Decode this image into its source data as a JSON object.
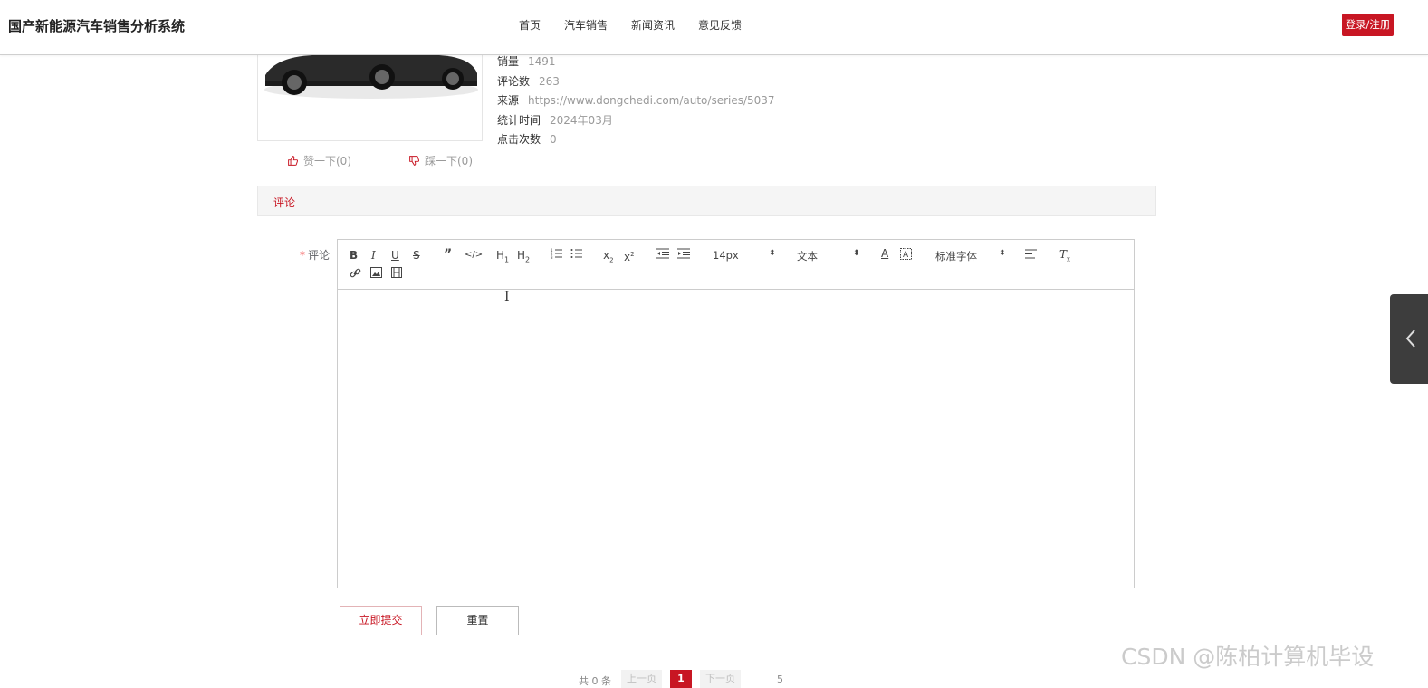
{
  "header": {
    "brand": "国产新能源汽车销售分析系统",
    "nav": [
      "首页",
      "汽车销售",
      "新闻资讯",
      "意见反馈"
    ],
    "login_label": "登录/注册"
  },
  "product": {
    "info": [
      {
        "label": "销量",
        "value": "1491"
      },
      {
        "label": "评论数",
        "value": "263"
      },
      {
        "label": "来源",
        "value": "https://www.dongchedi.com/auto/series/5037"
      },
      {
        "label": "统计时间",
        "value": "2024年03月"
      },
      {
        "label": "点击次数",
        "value": "0"
      }
    ],
    "like_label": "赞一下(0)",
    "dislike_label": "踩一下(0)"
  },
  "comment_section": {
    "title": "评论",
    "field_label": "评论",
    "required_mark": "*",
    "toolbar": {
      "size": "14px",
      "header": "文本",
      "font": "标准字体"
    },
    "submit_label": "立即提交",
    "reset_label": "重置"
  },
  "pagination": {
    "total": "共 0 条",
    "prev": "上一页",
    "current": "1",
    "next": "下一页",
    "size": "5"
  },
  "watermark": "CSDN @陈柏计算机毕设",
  "colors": {
    "accent": "#c81623",
    "side_tab": "#3d3d3d"
  }
}
